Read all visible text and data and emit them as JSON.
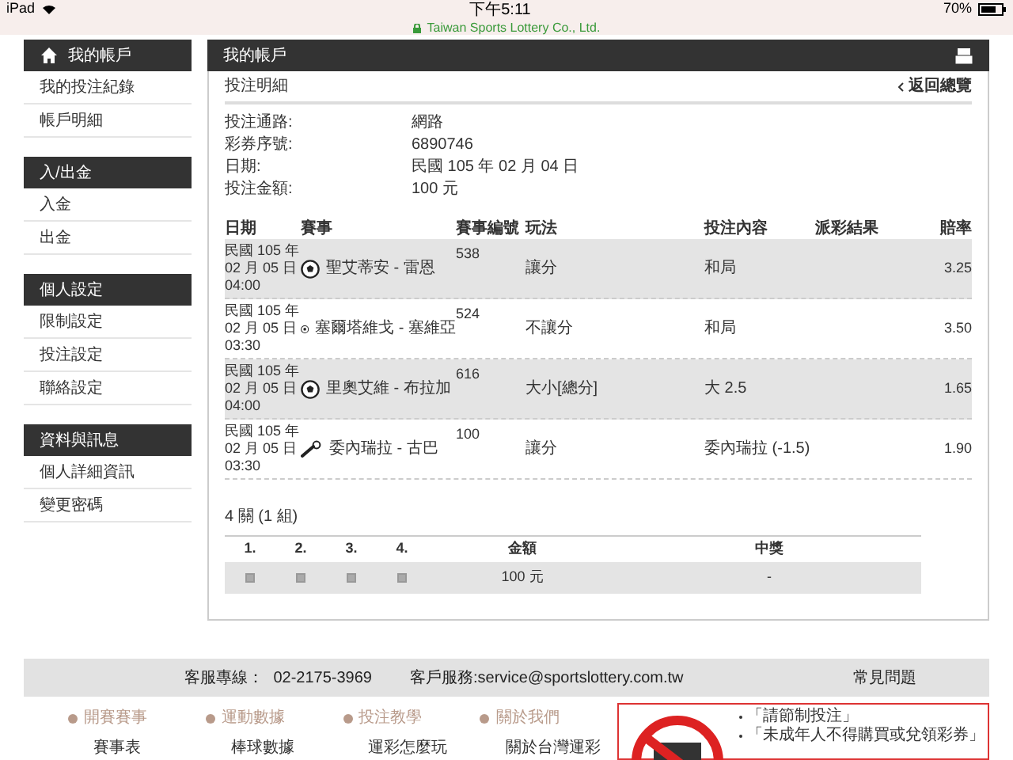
{
  "status_bar": {
    "device": "iPad",
    "time": "下午5:11",
    "battery": "70%",
    "site": "Taiwan Sports Lottery Co., Ltd."
  },
  "sidebar": {
    "sections": [
      {
        "title": "我的帳戶",
        "items": [
          "我的投注紀錄",
          "帳戶明細"
        ]
      },
      {
        "title": "入/出金",
        "items": [
          "入金",
          "出金"
        ]
      },
      {
        "title": "個人設定",
        "items": [
          "限制設定",
          "投注設定",
          "聯絡設定"
        ]
      },
      {
        "title": "資料與訊息",
        "items": [
          "個人詳細資訊",
          "變更密碼"
        ]
      }
    ]
  },
  "main": {
    "header": "我的帳戶",
    "subtitle": "投注明細",
    "back_link": "返回總覽",
    "details": [
      {
        "label": "投注通路:",
        "value": "網路"
      },
      {
        "label": "彩券序號:",
        "value": "6890746"
      },
      {
        "label": "日期:",
        "value": "民國 105 年 02 月 04 日"
      },
      {
        "label": "投注金額:",
        "value": "100 元"
      }
    ],
    "table": {
      "columns": [
        "日期",
        "賽事",
        "賽事編號",
        "玩法",
        "投注內容",
        "派彩結果",
        "賠率"
      ],
      "rows": [
        {
          "date": [
            "民國 105 年",
            "02 月 05 日",
            "04:00"
          ],
          "kind": "soccer",
          "match": "聖艾蒂安 - 雷恩",
          "number": "538",
          "bet_type": "讓分",
          "selection": "和局",
          "odds": "3.25"
        },
        {
          "date": [
            "民國 105 年",
            "02 月 05 日",
            "03:30"
          ],
          "kind": "soccer",
          "match": "塞爾塔維戈 - 塞維亞",
          "number": "524",
          "bet_type": "不讓分",
          "selection": "和局",
          "odds": "3.50"
        },
        {
          "date": [
            "民國 105 年",
            "02 月 05 日",
            "04:00"
          ],
          "kind": "soccer",
          "match": "里奧艾維 - 布拉加",
          "number": "616",
          "bet_type": "大小[總分]",
          "selection": "大 2.5",
          "odds": "1.65"
        },
        {
          "date": [
            "民國 105 年",
            "02 月 05 日",
            "03:30"
          ],
          "kind": "baseball",
          "match": "委內瑞拉 - 古巴",
          "number": "100",
          "bet_type": "讓分",
          "selection": "委內瑞拉 (-1.5)",
          "odds": "1.90"
        }
      ]
    },
    "combo_summary": "4 關 (1 組)",
    "combo_table": {
      "columns": [
        "1.",
        "2.",
        "3.",
        "4.",
        "金額",
        "中獎"
      ],
      "rows": [
        {
          "amount": "100 元",
          "prize": "-"
        }
      ]
    }
  },
  "footer": {
    "hotline_label": "客服專線：",
    "hotline": "02-2175-3969",
    "service": "客戶服務:service@sportslottery.com.tw",
    "faq": "常見問題",
    "columns": [
      {
        "title": "開賽賽事",
        "link": "賽事表"
      },
      {
        "title": "運動數據",
        "link": "棒球數據"
      },
      {
        "title": "投注教學",
        "link": "運彩怎麼玩"
      },
      {
        "title": "關於我們",
        "link": "關於台灣運彩"
      }
    ],
    "notices": [
      "「請節制投注」",
      "「未成年人不得購買或兌領彩券」"
    ]
  }
}
